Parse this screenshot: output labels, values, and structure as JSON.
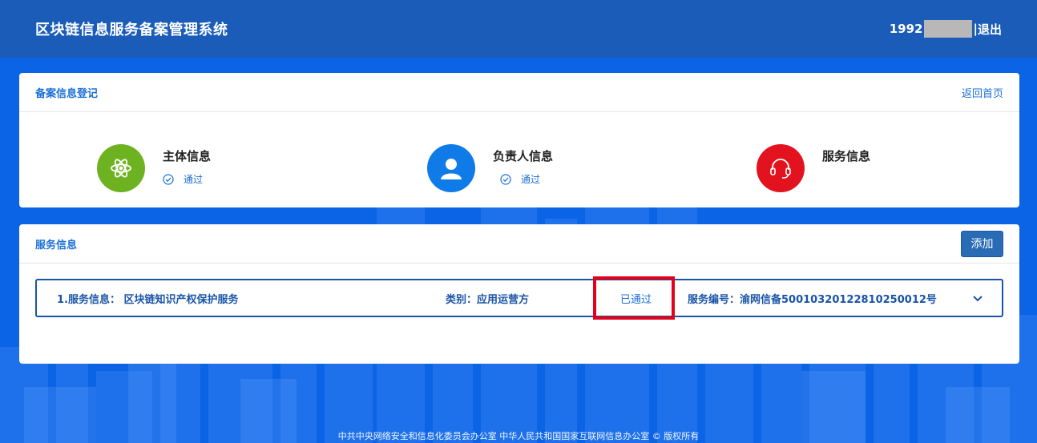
{
  "header": {
    "title": "区块链信息服务备案管理系统",
    "user_prefix": "1992",
    "separator": "|",
    "logout": "退出"
  },
  "registration": {
    "title": "备案信息登记",
    "back_link": "返回首页",
    "steps": [
      {
        "name": "主体信息",
        "status": "通过",
        "icon": "atom-icon",
        "color": "#6cb221"
      },
      {
        "name": "负责人信息",
        "status": "通过",
        "icon": "person-icon",
        "color": "#0f7be8"
      },
      {
        "name": "服务信息",
        "status": "",
        "icon": "headset-icon",
        "color": "#e2131f"
      }
    ]
  },
  "services": {
    "title": "服务信息",
    "add_label": "添加",
    "rows": [
      {
        "info": "1.服务信息： 区块链知识产权保护服务",
        "category": "类别：应用运营方",
        "status": "已通过",
        "number": "服务编号：渝网信备50010320122810250012号"
      }
    ]
  },
  "footer": {
    "text": "中共中央网络安全和信息化委员会办公室   中华人民共和国国家互联网信息办公室 © 版权所有"
  },
  "colors": {
    "page_bg": "#0b63e5",
    "header_bg": "#1a5cb8",
    "accent": "#1a6fd6",
    "highlight_box": "#e3001b"
  }
}
